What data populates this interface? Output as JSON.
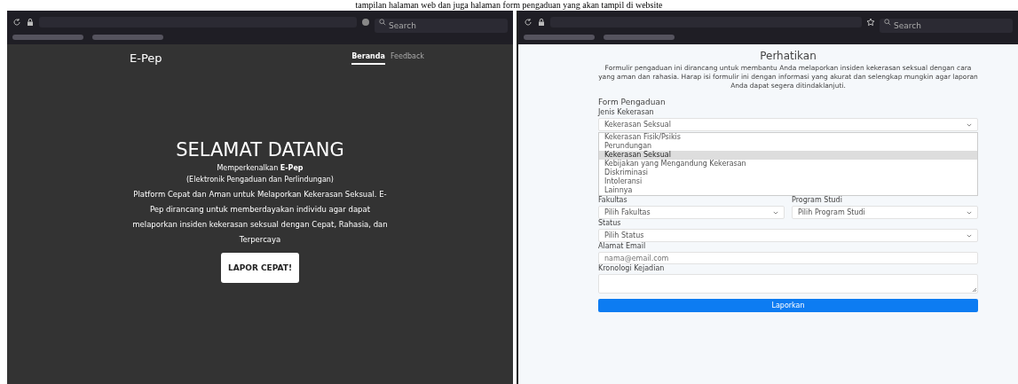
{
  "caption": "tampilan halaman web dan juga halaman form pengaduan yang akan tampil di website",
  "left": {
    "browser": {
      "search_placeholder": "Search"
    },
    "brand": "E-Pep",
    "nav": [
      {
        "label": "Beranda",
        "selected": true
      },
      {
        "label": "Feedback",
        "selected": false
      }
    ],
    "hero": {
      "title": "SELAMAT DATANG",
      "intro": "Memperkenalkan **E-Pep**",
      "subtitle": "(Elektronik Pengaduan dan Perlindungan)",
      "description": "Platform Cepat dan Aman untuk Melaporkan Kekerasan Seksual. E-Pep dirancang untuk memberdayakan individu agar dapat melaporkan insiden kekerasan seksual dengan Cepat, Rahasia, dan Terpercaya",
      "button": "LAPOR CEPAT!"
    }
  },
  "right": {
    "browser": {
      "search_placeholder": "Search"
    },
    "heading": "Perhatikan",
    "notice": "Formulir pengaduan ini dirancang untuk membantu Anda melaporkan insiden kekerasan seksual dengan cara yang aman dan rahasia. Harap isi formulir ini dengan informasi yang akurat dan selengkap mungkin agar laporan Anda dapat segera ditindaklanjuti.",
    "form": {
      "title": "Form Pengaduan",
      "rows": [
        {
          "fields": [
            {
              "kind": "select",
              "label": "Jenis Kekerasan",
              "value": "Kekerasan Seksual",
              "options": [
                {
                  "label": "Kekerasan Fisik/Psikis",
                  "selected": false
                },
                {
                  "label": "Perundungan",
                  "selected": false
                },
                {
                  "label": "Kekerasan Seksual",
                  "selected": true
                },
                {
                  "label": "Kebijakan yang Mengandung Kekerasan",
                  "selected": false
                },
                {
                  "label": "Diskriminasi",
                  "selected": false
                },
                {
                  "label": "Intoleransi",
                  "selected": false
                },
                {
                  "label": "Lainnya",
                  "selected": false
                }
              ]
            }
          ]
        },
        {
          "fields": [
            {
              "kind": "select",
              "label": "Fakultas",
              "value": "Pilih Fakultas"
            },
            {
              "kind": "select",
              "label": "Program Studi",
              "value": "Pilih Program Studi"
            }
          ]
        },
        {
          "fields": [
            {
              "kind": "select",
              "label": "Status",
              "value": "Pilih Status"
            }
          ]
        },
        {
          "fields": [
            {
              "kind": "input",
              "label": "Alamat Email",
              "placeholder": "nama@email.com"
            }
          ]
        },
        {
          "fields": [
            {
              "kind": "textarea",
              "label": "Kronologi Kejadian"
            }
          ]
        }
      ],
      "submit": "Laporkan"
    }
  }
}
